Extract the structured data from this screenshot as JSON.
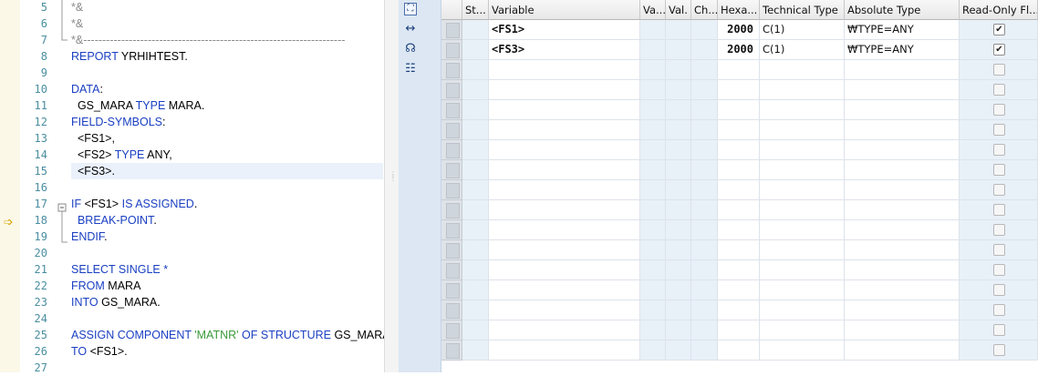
{
  "editor": {
    "lines": [
      {
        "num": "5",
        "text": "*&"
      },
      {
        "num": "6",
        "text": "*&"
      },
      {
        "num": "7",
        "text": "*&---------------------------------------------------------------------"
      },
      {
        "num": "8",
        "text": "REPORT YRHIHTEST."
      },
      {
        "num": "9",
        "text": ""
      },
      {
        "num": "10",
        "text": "DATA:"
      },
      {
        "num": "11",
        "text": "  GS_MARA TYPE MARA."
      },
      {
        "num": "12",
        "text": "FIELD-SYMBOLS:"
      },
      {
        "num": "13",
        "text": "  <FS1>,"
      },
      {
        "num": "14",
        "text": "  <FS2> TYPE ANY,"
      },
      {
        "num": "15",
        "text": "  <FS3>."
      },
      {
        "num": "16",
        "text": ""
      },
      {
        "num": "17",
        "text": "IF <FS1> IS ASSIGNED."
      },
      {
        "num": "18",
        "text": "  BREAK-POINT."
      },
      {
        "num": "19",
        "text": "ENDIF."
      },
      {
        "num": "20",
        "text": ""
      },
      {
        "num": "21",
        "text": "SELECT SINGLE *"
      },
      {
        "num": "22",
        "text": "FROM MARA"
      },
      {
        "num": "23",
        "text": "INTO GS_MARA."
      },
      {
        "num": "24",
        "text": ""
      },
      {
        "num": "25",
        "text": "ASSIGN COMPONENT 'MATNR' OF STRUCTURE GS_MARA"
      },
      {
        "num": "26",
        "text": "TO <FS1>."
      },
      {
        "num": "27",
        "text": ""
      }
    ],
    "current_line_marker": "➩"
  },
  "toolbar": {
    "icons": [
      "fit-screen-icon",
      "expand-columns-icon",
      "headset-icon",
      "settings-table-icon"
    ]
  },
  "variables_table": {
    "headers": [
      "St...",
      "Variable",
      "Va...",
      "Val.",
      "Ch...",
      "Hexa...",
      "Technical Type",
      "Absolute Type",
      "Read-Only Fl..."
    ],
    "rows": [
      {
        "variable": "<FS1>",
        "hex": "2000",
        "technical_type": "C(1)",
        "absolute_type": "₩TYPE=ANY",
        "read_only": true
      },
      {
        "variable": "<FS3>",
        "hex": "2000",
        "technical_type": "C(1)",
        "absolute_type": "₩TYPE=ANY",
        "read_only": true
      }
    ],
    "empty_rows": 15
  },
  "colors": {
    "keyword": "#1a3fc2",
    "comment": "#8a8a8a",
    "string": "#3a9a3a",
    "line_number": "#4a8ea0",
    "toolbar_bg": "#dce7f3",
    "grid_light": "#e8f0f8"
  }
}
